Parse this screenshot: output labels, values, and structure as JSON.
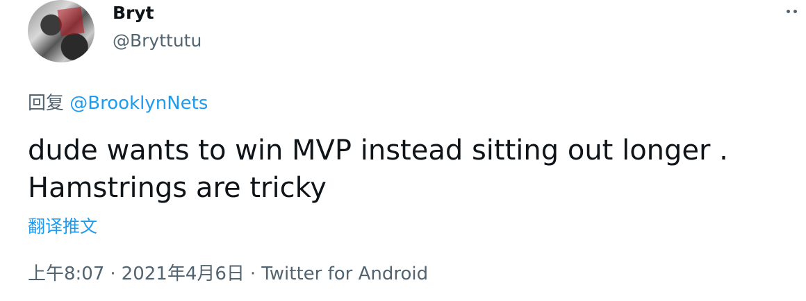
{
  "author": {
    "display_name": "Bryt",
    "handle": "@Bryttutu"
  },
  "reply": {
    "prefix": "回复",
    "mention": "@BrooklynNets"
  },
  "tweet": {
    "line1": "dude wants to win MVP instead sitting out longer .",
    "line2": "Hamstrings are tricky"
  },
  "translate_label": "翻译推文",
  "meta": {
    "time": "上午8:07",
    "separator": "·",
    "date": "2021年4月6日",
    "source": "Twitter for Android"
  },
  "icons": {
    "more": "more-horizontal-icon",
    "avatar": "user-avatar"
  },
  "colors": {
    "link": "#1d9bf0",
    "secondary_text": "#536471",
    "primary_text": "#0f1419"
  }
}
